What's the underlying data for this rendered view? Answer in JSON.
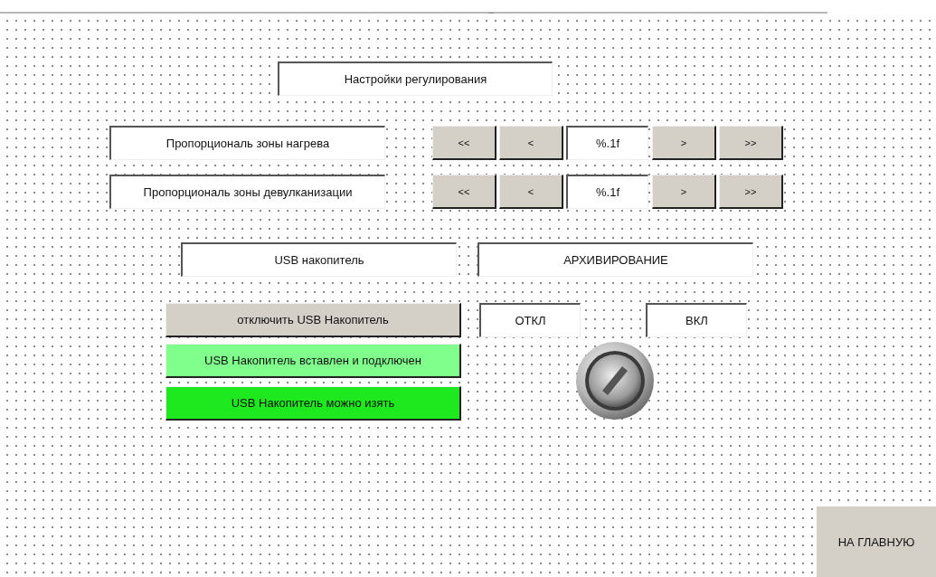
{
  "title_label": "Настройки регулирования",
  "settings": [
    {
      "label": "Пропорциональ зоны нагрева",
      "buttons": [
        "<<",
        "<",
        ">",
        ">>"
      ],
      "value": "%.1f"
    },
    {
      "label": "Пропорциональ зоны девулканизации",
      "buttons": [
        "<<",
        "<",
        ">",
        ">>"
      ],
      "value": "%.1f"
    }
  ],
  "usb": {
    "label": "USB накопитель",
    "buttons": [
      {
        "label": "отключить USB Накопитель",
        "color": "#d4d0c8"
      },
      {
        "label": "USB Накопитель вставлен и подключен",
        "color": "#80ff8c"
      },
      {
        "label": "USB Накопитель можно изять",
        "color": "#1ee81e"
      }
    ]
  },
  "archive": {
    "label": "АРХИВИРОВАНИЕ",
    "off_label": "ОТКЛ",
    "on_label": "ВКЛ"
  },
  "home_button": "НА ГЛАВНУЮ"
}
